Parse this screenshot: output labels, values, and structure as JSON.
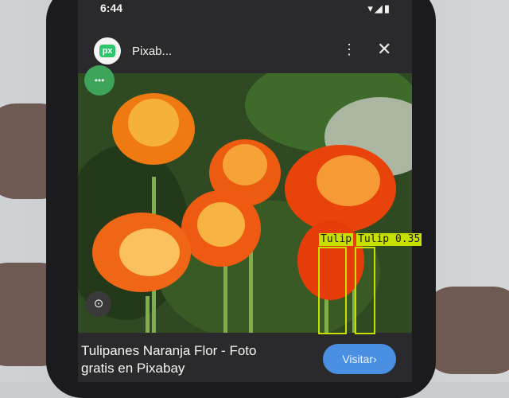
{
  "status_bar": {
    "time": "6:44",
    "icons": "▾◢▮"
  },
  "app_bar": {
    "title": "Pixab...",
    "logo_text": "px",
    "menu_icon": "⋮",
    "close_icon": "✕"
  },
  "overlay": {
    "green_circle_text": "•••",
    "lens_icon": "⊙"
  },
  "caption": {
    "line1": "Tulipanes Naranja Flor - Foto",
    "line2": "gratis en Pixabay"
  },
  "visit_button": {
    "label": "Visitar›"
  },
  "detections": [
    {
      "label": "Tulip"
    },
    {
      "label": "Tulip 0.35"
    }
  ],
  "colors": {
    "detection": "#c7e000",
    "visit": "#4a90e2",
    "accent_green": "#2ec66d"
  }
}
